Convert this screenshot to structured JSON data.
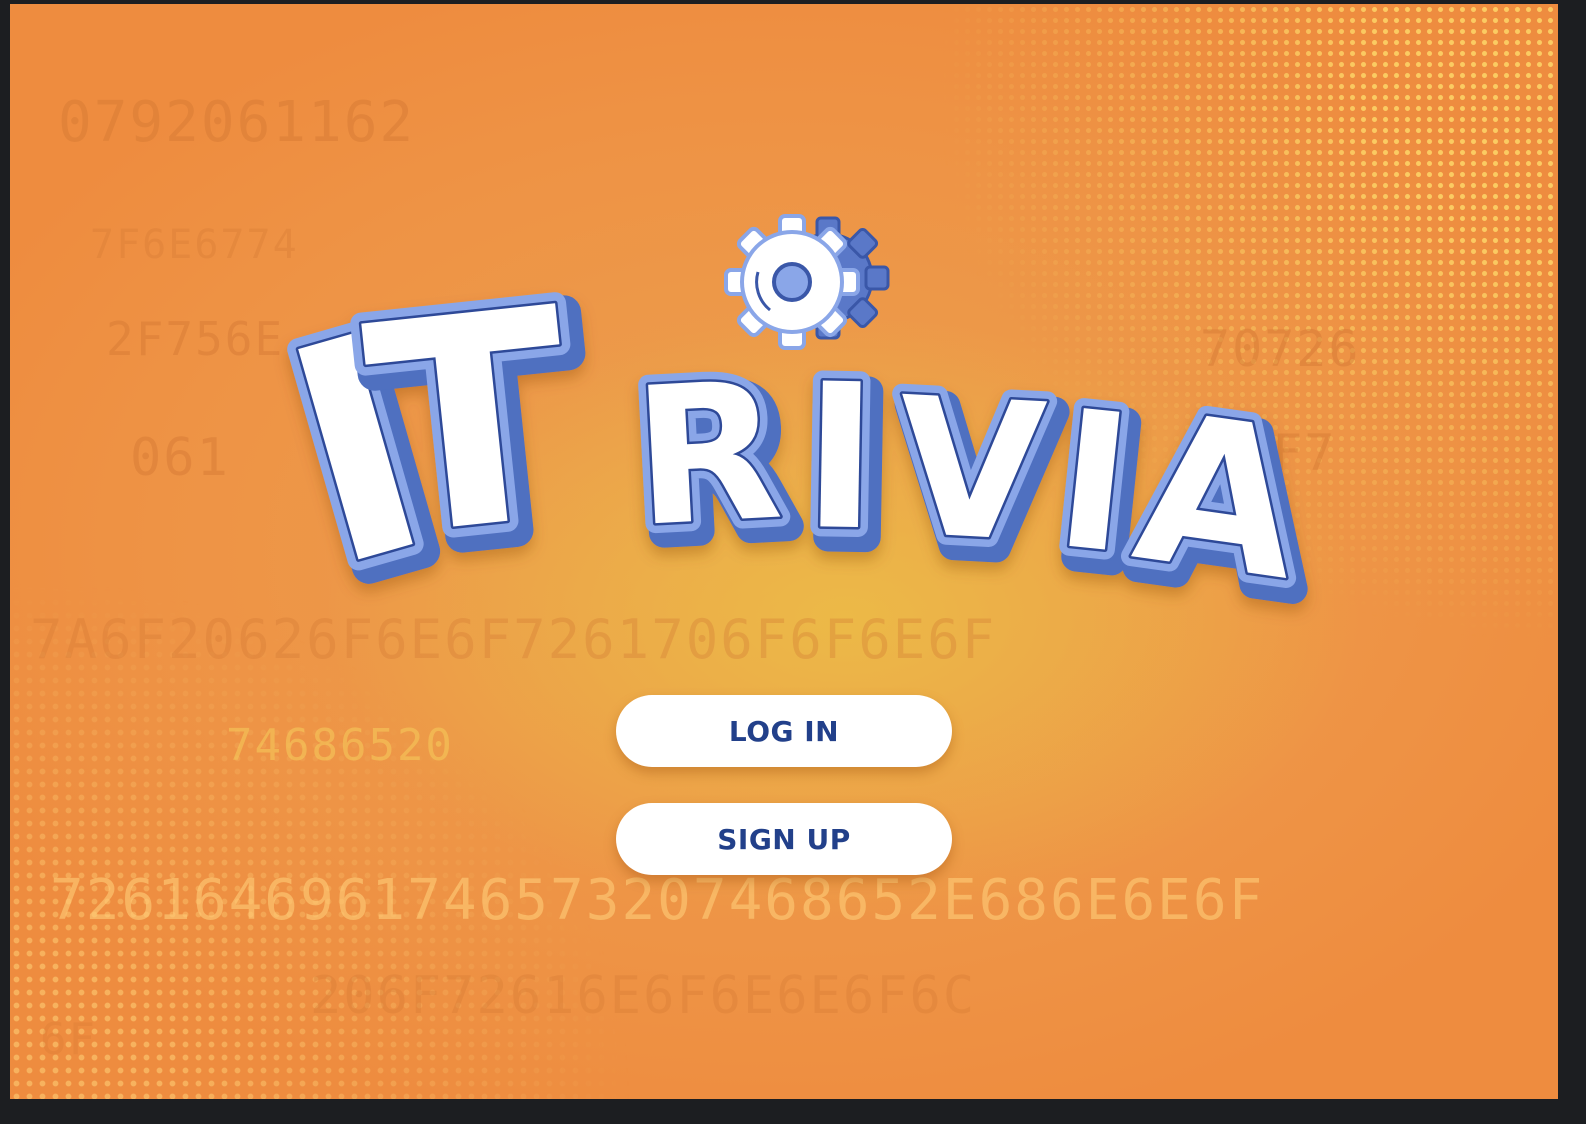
{
  "app": {
    "title": "ITRIVIA",
    "title_letters": [
      "I",
      "T",
      "R",
      "I",
      "V",
      "I",
      "A"
    ]
  },
  "buttons": {
    "login_label": "LOG IN",
    "signup_label": "SIGN UP"
  },
  "background": {
    "hex_lines": [
      "0792061162",
      "7F6E6774",
      "2F756E",
      "061",
      "7A6F20626F6E6F7261706F6F6E6F",
      "74686520",
      "7261646961746573207468652E686E6E6F",
      "206F72616E6F6E6E6F6C",
      "70726",
      "6F7",
      "6F"
    ]
  },
  "colors": {
    "background_orange": "#ee9345",
    "glow_yellow": "#ecbe46",
    "logo_fill": "#ffffff",
    "logo_light_blue": "#8aa6e8",
    "logo_dark_blue": "#3a57a8",
    "button_text": "#22408a",
    "frame": "#1c1e21"
  },
  "icons": {
    "logo_gear": "gear-icon"
  }
}
